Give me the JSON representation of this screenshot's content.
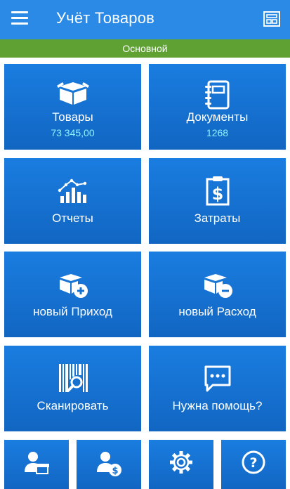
{
  "app": {
    "title": "Учёт Товаров",
    "mode": "Основной"
  },
  "tiles": [
    {
      "label": "Товары",
      "value": "73 345,00",
      "icon": "box-icon"
    },
    {
      "label": "Документы",
      "value": "1268",
      "icon": "document-icon"
    },
    {
      "label": "Отчеты",
      "icon": "chart-icon"
    },
    {
      "label": "Затраты",
      "icon": "expense-icon"
    },
    {
      "label": "новый Приход",
      "icon": "box-plus-icon"
    },
    {
      "label": "новый Расход",
      "icon": "box-minus-icon"
    },
    {
      "label": "Сканировать",
      "icon": "barcode-scan-icon"
    },
    {
      "label": "Нужна помощь?",
      "icon": "chat-icon"
    }
  ],
  "bottom_icons": [
    "supplier-icon",
    "customer-money-icon",
    "settings-gear-icon",
    "help-icon"
  ],
  "colors": {
    "appbar": "#2a8ae6",
    "subbar": "#5fa132",
    "tile": "#1a7de0",
    "accent_value": "#8ff3ff"
  }
}
